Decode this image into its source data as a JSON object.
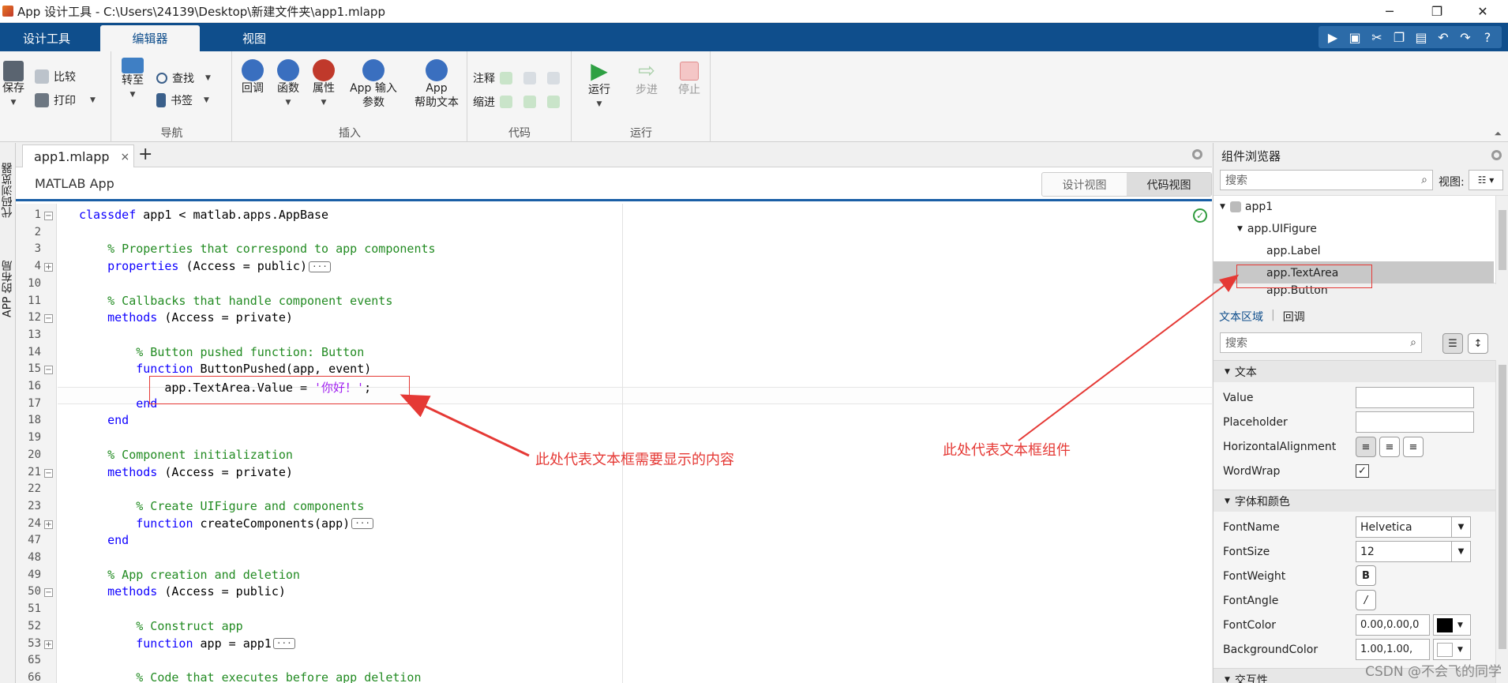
{
  "window": {
    "title": "App 设计工具 - C:\\Users\\24139\\Desktop\\新建文件夹\\app1.mlapp",
    "minimize": "─",
    "maximize": "❐",
    "close": "✕"
  },
  "tabs": [
    "设计工具",
    "编辑器",
    "视图"
  ],
  "ribbon": {
    "file": {
      "save": "保存",
      "compare": "比较",
      "print": "打印"
    },
    "nav": {
      "goto": "转至",
      "find": "查找",
      "bookmark": "书签",
      "group": "导航"
    },
    "insert": {
      "callback": "回调",
      "function": "函数",
      "property": "属性",
      "app_input_1": "App 输入",
      "app_input_2": "参数",
      "app_help_1": "App",
      "app_help_2": "帮助文本",
      "group": "插入"
    },
    "code": {
      "comment": "注释",
      "indent": "缩进",
      "group": "代码"
    },
    "run": {
      "run": "运行",
      "step": "步进",
      "stop": "停止",
      "group": "运行"
    }
  },
  "left_tabs": [
    "代码浏览器",
    "APP 的布局"
  ],
  "editor": {
    "doc_tab": "app1.mlapp",
    "doc_close": "×",
    "add_tab": "+",
    "app_label": "MATLAB App",
    "views": [
      "设计视图",
      "代码视图"
    ],
    "lines": [
      {
        "n": "1",
        "fold": "−",
        "code": [
          {
            "t": "classdef ",
            "c": "kw"
          },
          {
            "t": "app1 < matlab.apps.AppBase",
            "c": ""
          }
        ]
      },
      {
        "n": "2",
        "fold": "",
        "code": []
      },
      {
        "n": "3",
        "fold": "",
        "code": [
          {
            "t": "    ",
            "c": ""
          },
          {
            "t": "% Properties that correspond to app components",
            "c": "cm"
          }
        ]
      },
      {
        "n": "4",
        "fold": "+",
        "code": [
          {
            "t": "    ",
            "c": ""
          },
          {
            "t": "properties",
            "c": "kw"
          },
          {
            "t": " (Access = public)",
            "c": ""
          }
        ],
        "dots": "···"
      },
      {
        "n": "10",
        "fold": "",
        "code": []
      },
      {
        "n": "11",
        "fold": "",
        "code": [
          {
            "t": "    ",
            "c": ""
          },
          {
            "t": "% Callbacks that handle component events",
            "c": "cm"
          }
        ]
      },
      {
        "n": "12",
        "fold": "−",
        "code": [
          {
            "t": "    ",
            "c": ""
          },
          {
            "t": "methods",
            "c": "kw"
          },
          {
            "t": " (Access = private)",
            "c": ""
          }
        ]
      },
      {
        "n": "13",
        "fold": "",
        "code": []
      },
      {
        "n": "14",
        "fold": "",
        "code": [
          {
            "t": "        ",
            "c": ""
          },
          {
            "t": "% Button pushed function: Button",
            "c": "cm"
          }
        ]
      },
      {
        "n": "15",
        "fold": "−",
        "code": [
          {
            "t": "        ",
            "c": ""
          },
          {
            "t": "function",
            "c": "kw"
          },
          {
            "t": " ButtonPushed(app, event)",
            "c": ""
          }
        ]
      },
      {
        "n": "16",
        "fold": "",
        "code": [
          {
            "t": "            app.TextArea.Value = ",
            "c": ""
          },
          {
            "t": "'你好！'",
            "c": "st"
          },
          {
            "t": ";",
            "c": ""
          }
        ]
      },
      {
        "n": "17",
        "fold": "",
        "code": [
          {
            "t": "        ",
            "c": ""
          },
          {
            "t": "end",
            "c": "kw"
          }
        ]
      },
      {
        "n": "18",
        "fold": "",
        "code": [
          {
            "t": "    ",
            "c": ""
          },
          {
            "t": "end",
            "c": "kw"
          }
        ]
      },
      {
        "n": "19",
        "fold": "",
        "code": []
      },
      {
        "n": "20",
        "fold": "",
        "code": [
          {
            "t": "    ",
            "c": ""
          },
          {
            "t": "% Component initialization",
            "c": "cm"
          }
        ]
      },
      {
        "n": "21",
        "fold": "−",
        "code": [
          {
            "t": "    ",
            "c": ""
          },
          {
            "t": "methods",
            "c": "kw"
          },
          {
            "t": " (Access = private)",
            "c": ""
          }
        ]
      },
      {
        "n": "22",
        "fold": "",
        "code": []
      },
      {
        "n": "23",
        "fold": "",
        "code": [
          {
            "t": "        ",
            "c": ""
          },
          {
            "t": "% Create UIFigure and components",
            "c": "cm"
          }
        ]
      },
      {
        "n": "24",
        "fold": "+",
        "code": [
          {
            "t": "        ",
            "c": ""
          },
          {
            "t": "function",
            "c": "kw"
          },
          {
            "t": " createComponents(app)",
            "c": ""
          }
        ],
        "dots": "···"
      },
      {
        "n": "47",
        "fold": "",
        "code": [
          {
            "t": "    ",
            "c": ""
          },
          {
            "t": "end",
            "c": "kw"
          }
        ]
      },
      {
        "n": "48",
        "fold": "",
        "code": []
      },
      {
        "n": "49",
        "fold": "",
        "code": [
          {
            "t": "    ",
            "c": ""
          },
          {
            "t": "% App creation and deletion",
            "c": "cm"
          }
        ]
      },
      {
        "n": "50",
        "fold": "−",
        "code": [
          {
            "t": "    ",
            "c": ""
          },
          {
            "t": "methods",
            "c": "kw"
          },
          {
            "t": " (Access = public)",
            "c": ""
          }
        ]
      },
      {
        "n": "51",
        "fold": "",
        "code": []
      },
      {
        "n": "52",
        "fold": "",
        "code": [
          {
            "t": "        ",
            "c": ""
          },
          {
            "t": "% Construct app",
            "c": "cm"
          }
        ]
      },
      {
        "n": "53",
        "fold": "+",
        "code": [
          {
            "t": "        ",
            "c": ""
          },
          {
            "t": "function",
            "c": "kw"
          },
          {
            "t": " app = app1",
            "c": ""
          }
        ],
        "dots": "···"
      },
      {
        "n": "65",
        "fold": "",
        "code": []
      },
      {
        "n": "66",
        "fold": "",
        "code": [
          {
            "t": "        ",
            "c": ""
          },
          {
            "t": "% Code that executes before app deletion",
            "c": "cm"
          }
        ]
      }
    ]
  },
  "component_browser": {
    "title": "组件浏览器",
    "search_placeholder": "搜索",
    "view_label": "视图:",
    "tree": [
      "app1",
      "app.UIFigure",
      "app.Label",
      "app.TextArea",
      "app.Button"
    ],
    "selected": "app.TextArea",
    "subtabs": [
      "文本区域",
      "回调"
    ],
    "prop_search_placeholder": "搜索",
    "sections": {
      "text": "文本",
      "font": "字体和颜色",
      "interact": "交互性"
    },
    "props": {
      "value": {
        "label": "Value",
        "value": ""
      },
      "placeholder": {
        "label": "Placeholder",
        "value": ""
      },
      "halign": {
        "label": "HorizontalAlignment"
      },
      "wordwrap": {
        "label": "WordWrap",
        "value": "✓"
      },
      "fontname": {
        "label": "FontName",
        "value": "Helvetica"
      },
      "fontsize": {
        "label": "FontSize",
        "value": "12"
      },
      "fontweight": {
        "label": "FontWeight",
        "value": "B"
      },
      "fontangle": {
        "label": "FontAngle",
        "value": "/"
      },
      "fontcolor": {
        "label": "FontColor",
        "value": "0.00,0.00,0"
      },
      "bgcolor": {
        "label": "BackgroundColor",
        "value": "1.00,1.00,"
      }
    }
  },
  "annotations": {
    "code_note": "此处代表文本框需要显示的内容",
    "component_note": "此处代表文本框组件"
  },
  "watermark": "CSDN @不会飞的同学",
  "colors": {
    "accent": "#0f4e8c",
    "annotation": "#e53935",
    "keyword": "#0e00ff",
    "comment": "#228b22",
    "string": "#a020f0"
  }
}
